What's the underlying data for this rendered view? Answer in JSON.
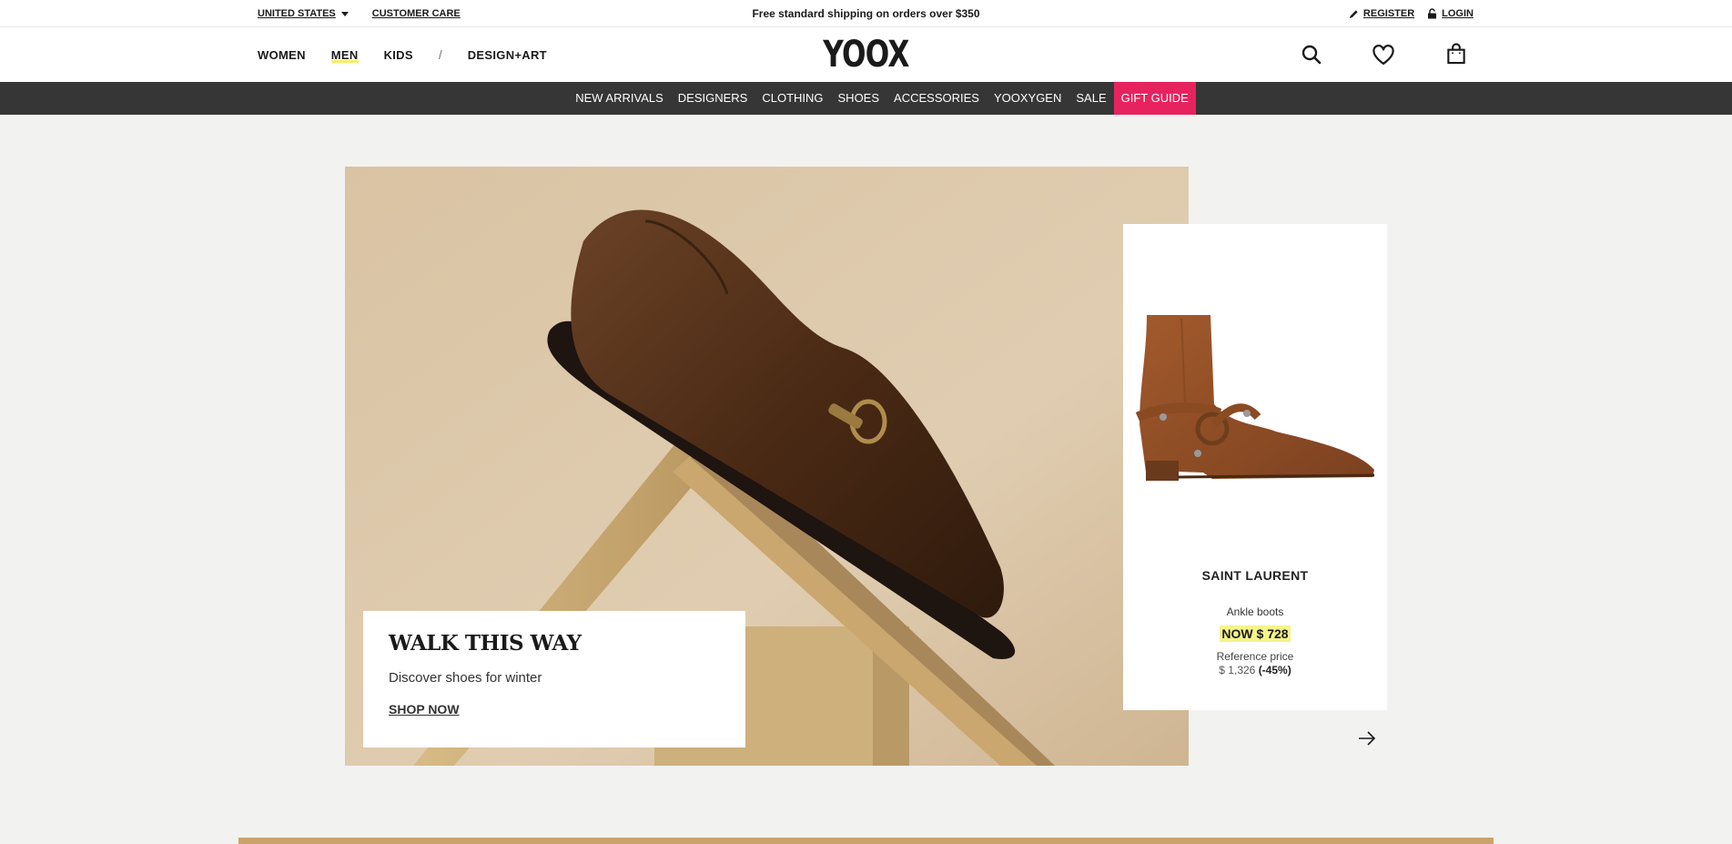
{
  "utility": {
    "country": "UNITED STATES",
    "customer_care": "CUSTOMER CARE",
    "promo": "Free standard shipping on orders over $350",
    "register": "REGISTER",
    "login": "LOGIN"
  },
  "header": {
    "logo": "YOOX",
    "gender_nav": [
      "WOMEN",
      "MEN",
      "KIDS",
      "DESIGN+ART"
    ],
    "separator": "/",
    "active_gender": "MEN",
    "icons": [
      "search-icon",
      "heart-icon",
      "shopping-bag-icon"
    ]
  },
  "category_nav": {
    "items": [
      "NEW ARRIVALS",
      "DESIGNERS",
      "CLOTHING",
      "SHOES",
      "ACCESSORIES",
      "YOOXYGEN",
      "SALE",
      "GIFT GUIDE"
    ],
    "highlight_color": "#e6235e",
    "background": "#363636"
  },
  "hero": {
    "title": "WALK THIS WAY",
    "subtitle": "Discover shoes for winter",
    "cta": "SHOP NOW"
  },
  "product": {
    "brand": "SAINT LAURENT",
    "type": "Ankle boots",
    "price_now": "NOW $ 728",
    "reference_label": "Reference price",
    "reference_price": "$ 1,326",
    "discount": "(-45%)",
    "price_highlight": "#f6f38b"
  },
  "carousel": {
    "next_icon": "arrow-right-icon"
  }
}
